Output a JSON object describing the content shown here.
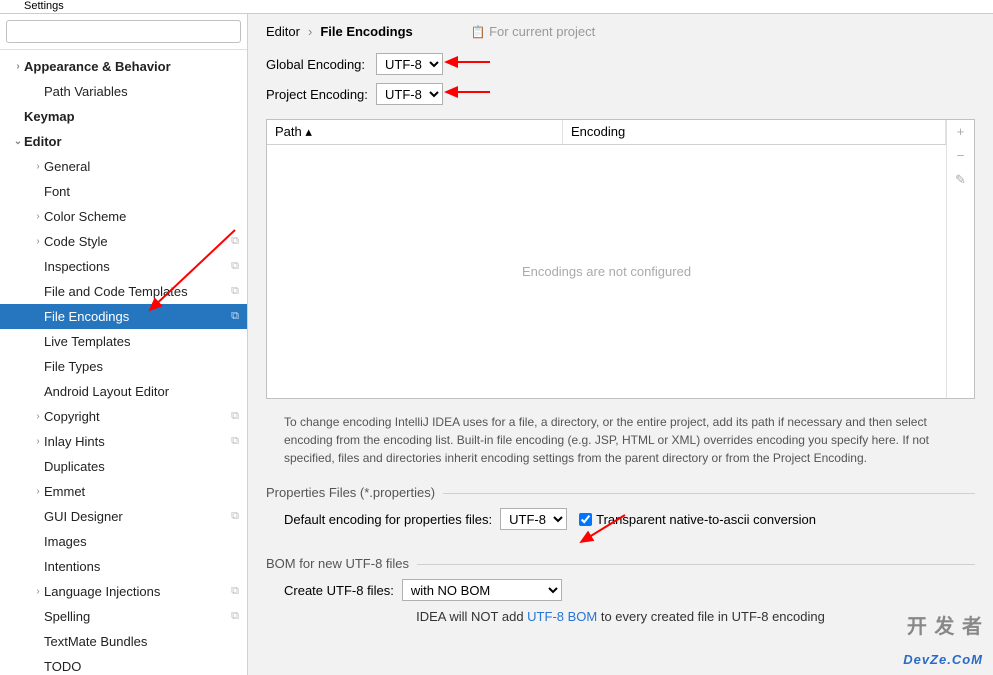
{
  "titlebar": "Settings",
  "search": {
    "placeholder": ""
  },
  "tree": [
    {
      "label": "Appearance & Behavior",
      "level": 0,
      "exp": true
    },
    {
      "label": "Path Variables",
      "level": 1
    },
    {
      "label": "Keymap",
      "level": 0
    },
    {
      "label": "Editor",
      "level": 0,
      "exp": true,
      "open": true
    },
    {
      "label": "General",
      "level": 1,
      "exp": true
    },
    {
      "label": "Font",
      "level": 1
    },
    {
      "label": "Color Scheme",
      "level": 1,
      "exp": true
    },
    {
      "label": "Code Style",
      "level": 1,
      "exp": true,
      "cog": true
    },
    {
      "label": "Inspections",
      "level": 1,
      "cog": true
    },
    {
      "label": "File and Code Templates",
      "level": 1,
      "cog": true
    },
    {
      "label": "File Encodings",
      "level": 1,
      "cog": true,
      "selected": true
    },
    {
      "label": "Live Templates",
      "level": 1
    },
    {
      "label": "File Types",
      "level": 1
    },
    {
      "label": "Android Layout Editor",
      "level": 1
    },
    {
      "label": "Copyright",
      "level": 1,
      "exp": true,
      "cog": true
    },
    {
      "label": "Inlay Hints",
      "level": 1,
      "exp": true,
      "cog": true
    },
    {
      "label": "Duplicates",
      "level": 1
    },
    {
      "label": "Emmet",
      "level": 1,
      "exp": true
    },
    {
      "label": "GUI Designer",
      "level": 1,
      "cog": true
    },
    {
      "label": "Images",
      "level": 1
    },
    {
      "label": "Intentions",
      "level": 1
    },
    {
      "label": "Language Injections",
      "level": 1,
      "exp": true,
      "cog": true
    },
    {
      "label": "Spelling",
      "level": 1,
      "cog": true
    },
    {
      "label": "TextMate Bundles",
      "level": 1
    },
    {
      "label": "TODO",
      "level": 1
    }
  ],
  "breadcrumb": {
    "parent": "Editor",
    "current": "File Encodings",
    "hint": "For current project"
  },
  "globalEncoding": {
    "label": "Global Encoding:",
    "value": "UTF-8"
  },
  "projectEncoding": {
    "label": "Project Encoding:",
    "value": "UTF-8"
  },
  "table": {
    "col1": "Path",
    "col2": "Encoding",
    "empty": "Encodings are not configured"
  },
  "helpText": "To change encoding IntelliJ IDEA uses for a file, a directory, or the entire project, add its path if necessary and then select encoding from the encoding list. Built-in file encoding (e.g. JSP, HTML or XML) overrides encoding you specify here. If not specified, files and directories inherit encoding settings from the parent directory or from the Project Encoding.",
  "props": {
    "legend": "Properties Files (*.properties)",
    "label": "Default encoding for properties files:",
    "value": "UTF-8",
    "cbLabel": "Transparent native-to-ascii conversion",
    "checked": true
  },
  "bom": {
    "legend": "BOM for new UTF-8 files",
    "label": "Create UTF-8 files:",
    "value": "with NO BOM",
    "note1": "IDEA will NOT add ",
    "noteLink": "UTF-8 BOM",
    "note2": " to every created file in UTF-8 encoding"
  },
  "watermark": {
    "cn": "开 发 者",
    "en": "DevZe.CoM"
  }
}
